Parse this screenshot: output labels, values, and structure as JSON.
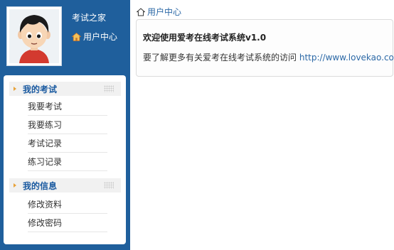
{
  "sidebar": {
    "site_name": "考试之家",
    "user_center_label": "用户中心",
    "sections": [
      {
        "title": "我的考试",
        "items": [
          "我要考试",
          "我要练习",
          "考试记录",
          "练习记录"
        ]
      },
      {
        "title": "我的信息",
        "items": [
          "修改资料",
          "修改密码"
        ]
      }
    ]
  },
  "main": {
    "breadcrumb_label": "用户中心",
    "welcome_title": "欢迎使用爱考在线考试系统v1.0",
    "welcome_text": "要了解更多有关爱考在线考试系统的访问",
    "welcome_link": "http://www.lovekao.com",
    "welcome_period": "."
  },
  "colors": {
    "sidebar_bg": "#1f5f9c",
    "section_title": "#1a5aa0",
    "link": "#2b68a6",
    "arrow": "#e8a33a"
  },
  "icons": {
    "user_center": "house-icon",
    "breadcrumb": "home-icon",
    "section": "arrow-right-icon"
  }
}
